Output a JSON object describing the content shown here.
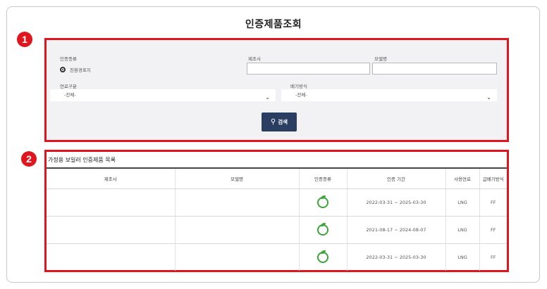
{
  "page_title": "인증제품조회",
  "markers": {
    "one": "1",
    "two": "2"
  },
  "search": {
    "cert_type_label": "인증종류",
    "cert_type_option": "친환경표지",
    "manufacturer_label": "제조사",
    "model_label": "모델명",
    "manufacturer_value": "",
    "model_value": "",
    "fuel_label": "연료구분",
    "fuel_selected": "-전체-",
    "exhaust_label": "배기방식",
    "exhaust_selected": "-전체-",
    "search_button": "검색"
  },
  "list": {
    "title": "가정용 보일러 인증제품 목록",
    "columns": [
      "제조사",
      "모델명",
      "인증종류",
      "인증 기간",
      "사용연료",
      "급배기방식"
    ],
    "rows": [
      {
        "manufacturer": "",
        "model": "",
        "cert_icon": "eco-label-icon",
        "period": "2022-03-31 ~ 2025-03-30",
        "fuel": "LNG",
        "exhaust": "FF"
      },
      {
        "manufacturer": "",
        "model": "",
        "cert_icon": "eco-label-icon",
        "period": "2021-08-17 ~ 2024-08-07",
        "fuel": "LNG",
        "exhaust": "FF"
      },
      {
        "manufacturer": "",
        "model": "",
        "cert_icon": "eco-label-icon",
        "period": "2022-03-31 ~ 2025-03-30",
        "fuel": "LNG",
        "exhaust": "FF"
      }
    ]
  },
  "colors": {
    "highlight": "#e0161e",
    "button": "#2a3e62",
    "eco_green": "#3da33a"
  }
}
